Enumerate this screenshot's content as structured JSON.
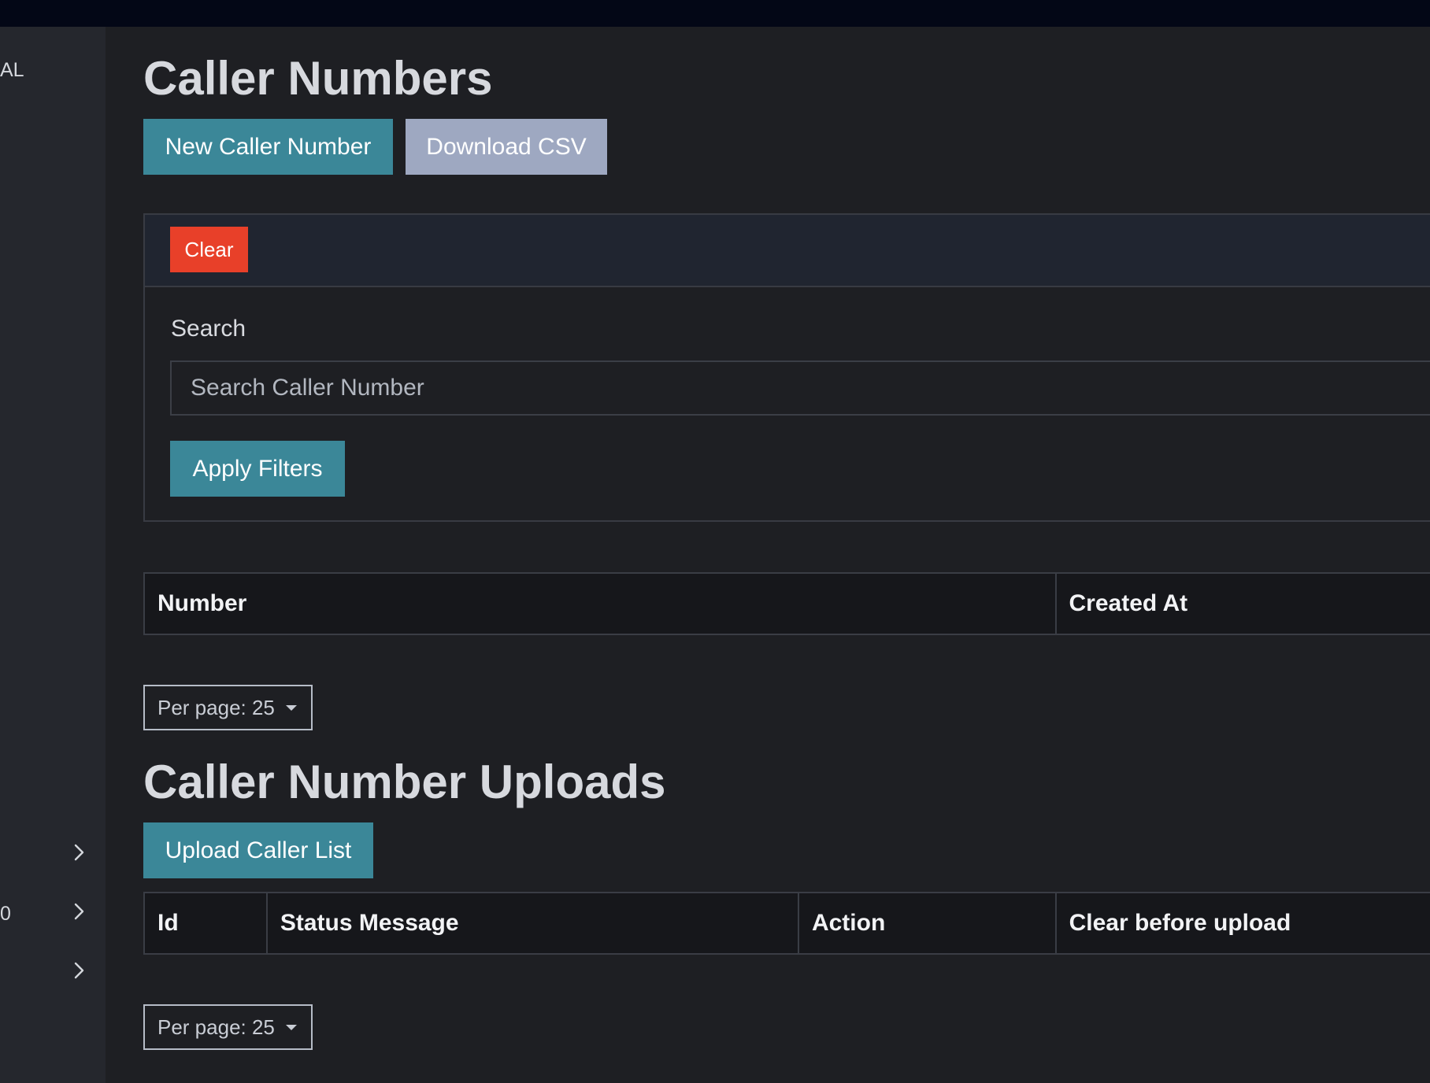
{
  "sidebar": {
    "items": [
      {
        "label": "AL"
      },
      {
        "label": ""
      },
      {
        "label": "0"
      },
      {
        "label": ""
      }
    ]
  },
  "caller_numbers": {
    "title": "Caller Numbers",
    "new_button": "New Caller Number",
    "download_button": "Download CSV",
    "clear_button": "Clear",
    "search_label": "Search",
    "search_placeholder": "Search Caller Number",
    "apply_button": "Apply Filters",
    "table_headers": [
      "Number",
      "Created At"
    ],
    "per_page": "Per page: 25"
  },
  "caller_number_uploads": {
    "title": "Caller Number Uploads",
    "upload_button": "Upload Caller List",
    "table_headers": [
      "Id",
      "Status Message",
      "Action",
      "Clear before upload"
    ],
    "per_page": "Per page: 25"
  },
  "colors": {
    "accent": "#3b8798",
    "secondary": "#9ea8c1",
    "danger": "#e84029",
    "background": "#1e1f23",
    "sidebar": "#25272d",
    "topbar": "#030716"
  }
}
